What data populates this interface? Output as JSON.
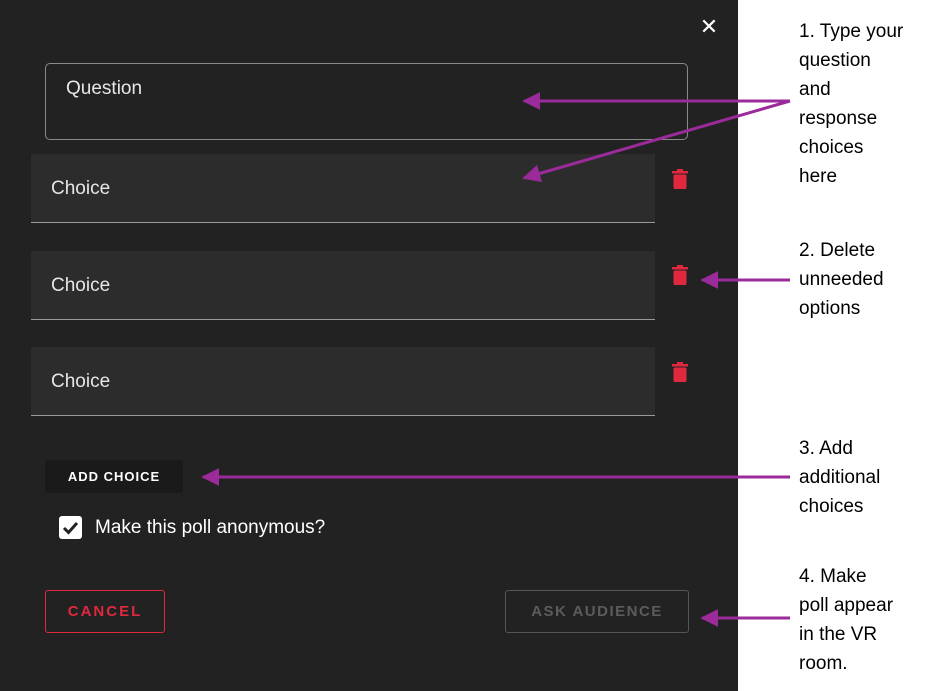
{
  "dialog": {
    "close_glyph": "✕",
    "question_placeholder": "Question",
    "choices": [
      "Choice",
      "Choice",
      "Choice"
    ],
    "add_choice_label": "ADD CHOICE",
    "anonymous_label": "Make this poll anonymous?",
    "anonymous_checked": true,
    "cancel_label": "CANCEL",
    "ask_label": "ASK AUDIENCE",
    "icons": {
      "close": "close-icon",
      "delete": "trash-icon",
      "check": "checkmark-icon"
    }
  },
  "annotations": {
    "note1": [
      "1. Type your",
      "question",
      "and",
      "response",
      "choices",
      "here"
    ],
    "note2": [
      "2. Delete",
      "unneeded",
      "options"
    ],
    "note3": [
      "3. Add",
      "additional",
      "choices"
    ],
    "note4": [
      "4. Make",
      "poll appear",
      "in the VR",
      "room."
    ]
  },
  "colors": {
    "panel_bg": "#222222",
    "choice_bg": "#2c2c2c",
    "accent_red": "#e0293f",
    "arrow_purple": "#9b2a9a",
    "disabled_text": "#5c5c5c"
  }
}
